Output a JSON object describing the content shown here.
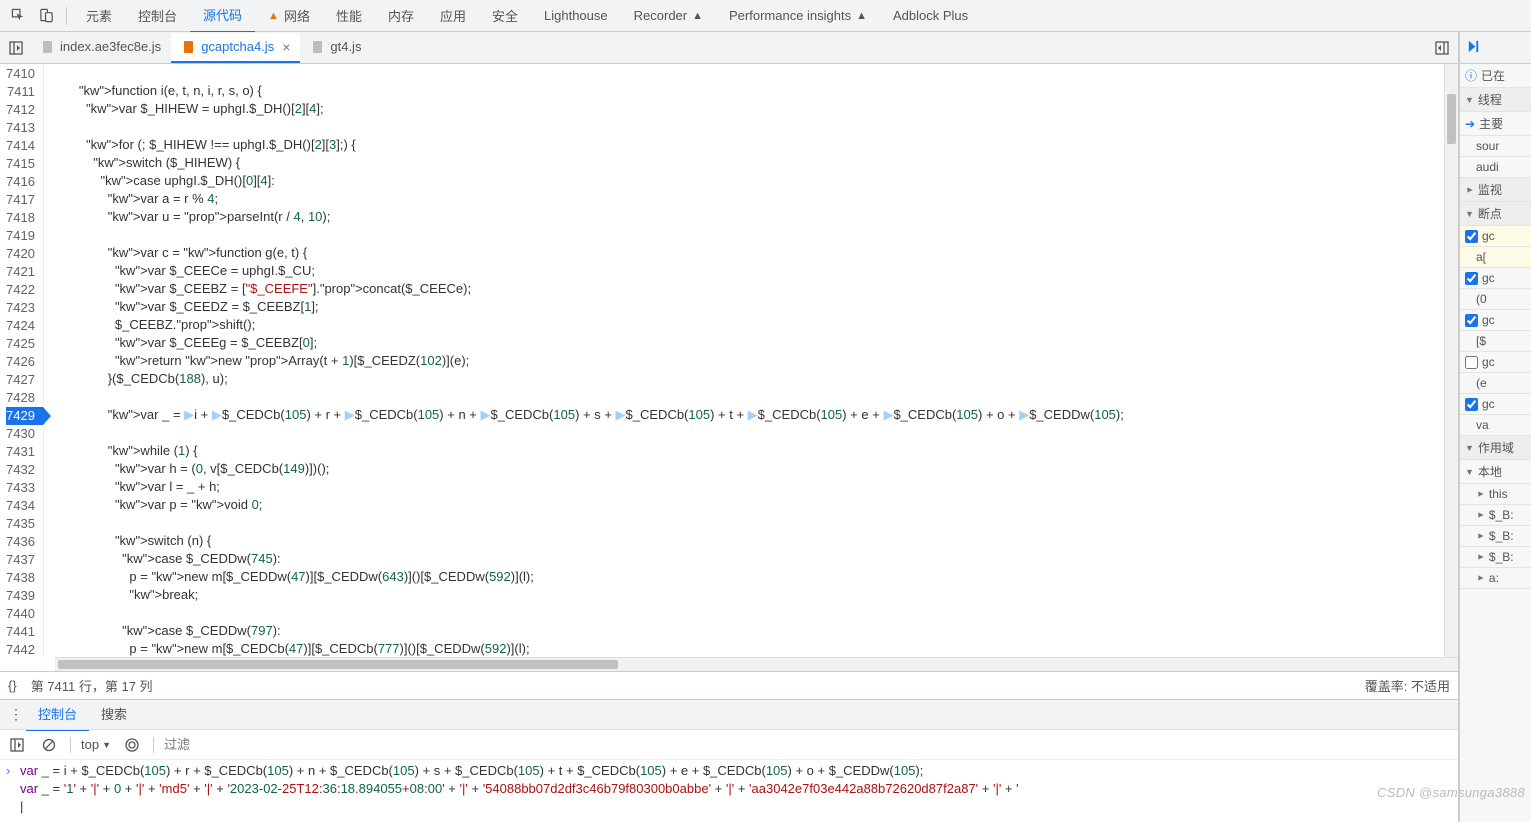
{
  "toptabs": {
    "items": [
      "元素",
      "控制台",
      "源代码",
      "网络",
      "性能",
      "内存",
      "应用",
      "安全",
      "Lighthouse",
      "Recorder",
      "Performance insights",
      "Adblock Plus"
    ],
    "activeIndex": 2,
    "networkWarn": true,
    "recorderBadge": true,
    "perfBadge": true
  },
  "filetabs": {
    "items": [
      {
        "name": "index.ae3fec8e.js",
        "closable": false
      },
      {
        "name": "gcaptcha4.js",
        "closable": true
      },
      {
        "name": "gt4.js",
        "closable": false
      }
    ],
    "activeIndex": 1
  },
  "gutter": {
    "start": 7410,
    "end": 7442,
    "highlight": 7429
  },
  "code": {
    "7410": "",
    "7411": "        function i(e, t, n, i, r, s, o) {",
    "7412": "          var $_HIHEW = uphgI.$_DH()[2][4];",
    "7413": "",
    "7414": "          for (; $_HIHEW !== uphgI.$_DH()[2][3];) {",
    "7415": "            switch ($_HIHEW) {",
    "7416": "              case uphgI.$_DH()[0][4]:",
    "7417": "                var a = r % 4;",
    "7418": "                var u = parseInt(r / 4, 10);",
    "7419": "",
    "7420": "                var c = function g(e, t) {",
    "7421": "                  var $_CEECe = uphgI.$_CU;",
    "7422": "                  var $_CEEBZ = [\"$_CEEFE\"].concat($_CEECe);",
    "7423": "                  var $_CEEDZ = $_CEEBZ[1];",
    "7424": "                  $_CEEBZ.shift();",
    "7425": "                  var $_CEEEg = $_CEEBZ[0];",
    "7426": "                  return new Array(t + 1)[$_CEEDZ(102)](e);",
    "7427": "                }($_CEDCb(188), u);",
    "7428": "",
    "7429": "                var _ = ▶i + ▶$_CEDCb(105) + r + ▶$_CEDCb(105) + n + ▶$_CEDCb(105) + s + ▶$_CEDCb(105) + t + ▶$_CEDCb(105) + e + ▶$_CEDCb(105) + o + ▶$_CEDDw(105);",
    "7430": "",
    "7431": "                while (1) {",
    "7432": "                  var h = (0, v[$_CEDCb(149)])();",
    "7433": "                  var l = _ + h;",
    "7434": "                  var p = void 0;",
    "7435": "",
    "7436": "                  switch (n) {",
    "7437": "                    case $_CEDDw(745):",
    "7438": "                      p = new m[$_CEDDw(47)][$_CEDDw(643)]()[$_CEDDw(592)](l);",
    "7439": "                      break;",
    "7440": "",
    "7441": "                    case $_CEDDw(797):",
    "7442": "                      p = new m[$_CEDCb(47)][$_CEDCb(777)]()[$_CEDDw(592)](l);"
  },
  "status": {
    "curly": "{}",
    "pos": "第 7411 行，第 17 列",
    "coverage": "覆盖率: 不适用"
  },
  "consoleTabs": {
    "items": [
      "控制台",
      "搜索"
    ],
    "activeIndex": 0
  },
  "consoleBar": {
    "context": "top",
    "filterPlaceholder": "过滤"
  },
  "consoleBody": {
    "line1": "var _ = i + $_CEDCb(105) + r + $_CEDCb(105) + n + $_CEDCb(105) + s + $_CEDCb(105) + t + $_CEDCb(105) + e + $_CEDCb(105) + o + $_CEDDw(105);",
    "line2": "var _ = '1' + '|' + 0 + '|' + 'md5' + '|' + '2023-02-25T12:36:18.894055+08:00' + '|' + '54088bb07d2df3c46b79f80300b0abbe' + '|' + 'aa3042e7f03e442a88b72620d87f2a87' + '|' + '"
  },
  "right": {
    "paused": "已在",
    "threads": "线程",
    "main": "主要",
    "sour": "sour",
    "audi": "audi",
    "watch": "监视",
    "break": "断点",
    "bp": [
      {
        "checked": true,
        "label": "gc",
        "sub": "a[",
        "hl": true
      },
      {
        "checked": true,
        "label": "gc",
        "sub": "(0"
      },
      {
        "checked": true,
        "label": "gc",
        "sub": "[$"
      },
      {
        "checked": false,
        "label": "gc",
        "sub": "(e"
      },
      {
        "checked": true,
        "label": "gc",
        "sub": "va"
      }
    ],
    "scope": "作用域",
    "local": "本地",
    "vars": [
      "this",
      "$_B:",
      "$_B:",
      "$_B:",
      "a: "
    ]
  },
  "watermark": "CSDN @samsunga3888"
}
